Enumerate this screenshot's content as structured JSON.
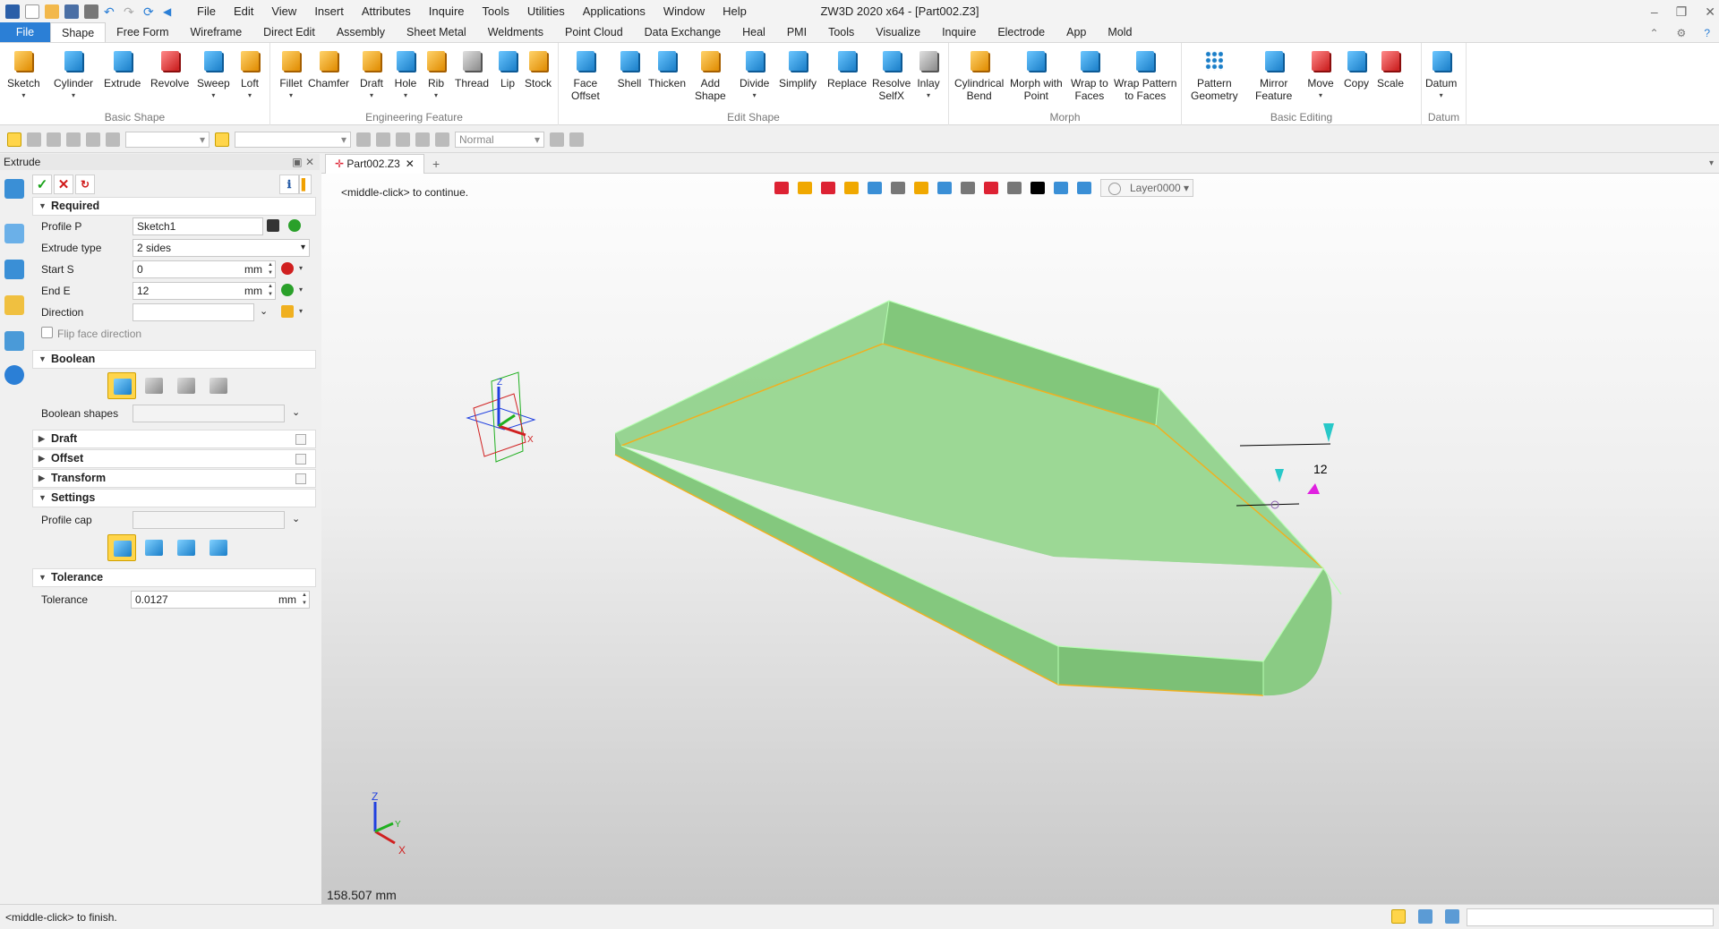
{
  "window": {
    "title": "ZW3D 2020 x64 - [Part002.Z3]",
    "controls": [
      "‒",
      "❐",
      "✕"
    ]
  },
  "menu": [
    "File",
    "Edit",
    "View",
    "Insert",
    "Attributes",
    "Inquire",
    "Tools",
    "Utilities",
    "Applications",
    "Window",
    "Help"
  ],
  "ribbon_tabs": [
    "File",
    "Shape",
    "Free Form",
    "Wireframe",
    "Direct Edit",
    "Assembly",
    "Sheet Metal",
    "Weldments",
    "Point Cloud",
    "Data Exchange",
    "Heal",
    "PMI",
    "Tools",
    "Visualize",
    "Inquire",
    "Electrode",
    "App",
    "Mold"
  ],
  "ribbon_active_tab": "Shape",
  "ribbon_groups": {
    "basic_shape": {
      "label": "Basic Shape",
      "buttons": [
        "Sketch",
        "Cylinder",
        "Extrude",
        "Revolve",
        "Sweep",
        "Loft"
      ]
    },
    "engineering_feature": {
      "label": "Engineering Feature",
      "buttons": [
        "Fillet",
        "Chamfer",
        "Draft",
        "Hole",
        "Rib",
        "Thread",
        "Lip",
        "Stock"
      ]
    },
    "edit_shape": {
      "label": "Edit Shape",
      "buttons": [
        "Face\nOffset",
        "Shell",
        "Thicken",
        "Add\nShape",
        "Divide",
        "Simplify",
        "Replace",
        "Resolve\nSelfX",
        "Inlay"
      ]
    },
    "morph": {
      "label": "Morph",
      "buttons": [
        "Cylindrical\nBend",
        "Morph with\nPoint",
        "Wrap to\nFaces",
        "Wrap Pattern\nto Faces"
      ]
    },
    "basic_editing": {
      "label": "Basic Editing",
      "buttons": [
        "Pattern\nGeometry",
        "Mirror\nFeature",
        "Move",
        "Copy",
        "Scale"
      ]
    },
    "datum": {
      "label": "Datum",
      "buttons": [
        "Datum"
      ]
    }
  },
  "toolbar": {
    "mode_combo": "Normal"
  },
  "panel": {
    "title": "Extrude",
    "required": {
      "header": "Required",
      "profile_label": "Profile P",
      "profile_value": "Sketch1",
      "type_label": "Extrude type",
      "type_value": "2 sides",
      "start_label": "Start S",
      "start_value": "0",
      "start_unit": "mm",
      "end_label": "End E",
      "end_value": "12",
      "end_unit": "mm",
      "direction_label": "Direction",
      "direction_value": "",
      "flip_label": "Flip face direction"
    },
    "boolean": {
      "header": "Boolean",
      "shapes_label": "Boolean shapes"
    },
    "draft_header": "Draft",
    "offset_header": "Offset",
    "transform_header": "Transform",
    "settings": {
      "header": "Settings",
      "profile_cap_label": "Profile cap"
    },
    "tolerance": {
      "header": "Tolerance",
      "label": "Tolerance",
      "value": "0.0127",
      "unit": "mm"
    }
  },
  "document_tab": "Part002.Z3",
  "viewport": {
    "hint": "<middle-click> to continue.",
    "layer": "Layer0000",
    "dimension_label": "12",
    "measure": "158.507 mm",
    "triad_labels": {
      "z": "Z",
      "y": "Y",
      "x": "X"
    }
  },
  "status": "<middle-click> to finish.",
  "colors": {
    "accent": "#2b7fd6",
    "part_fill": "#8fd18a",
    "highlight": "#ffd54a"
  }
}
